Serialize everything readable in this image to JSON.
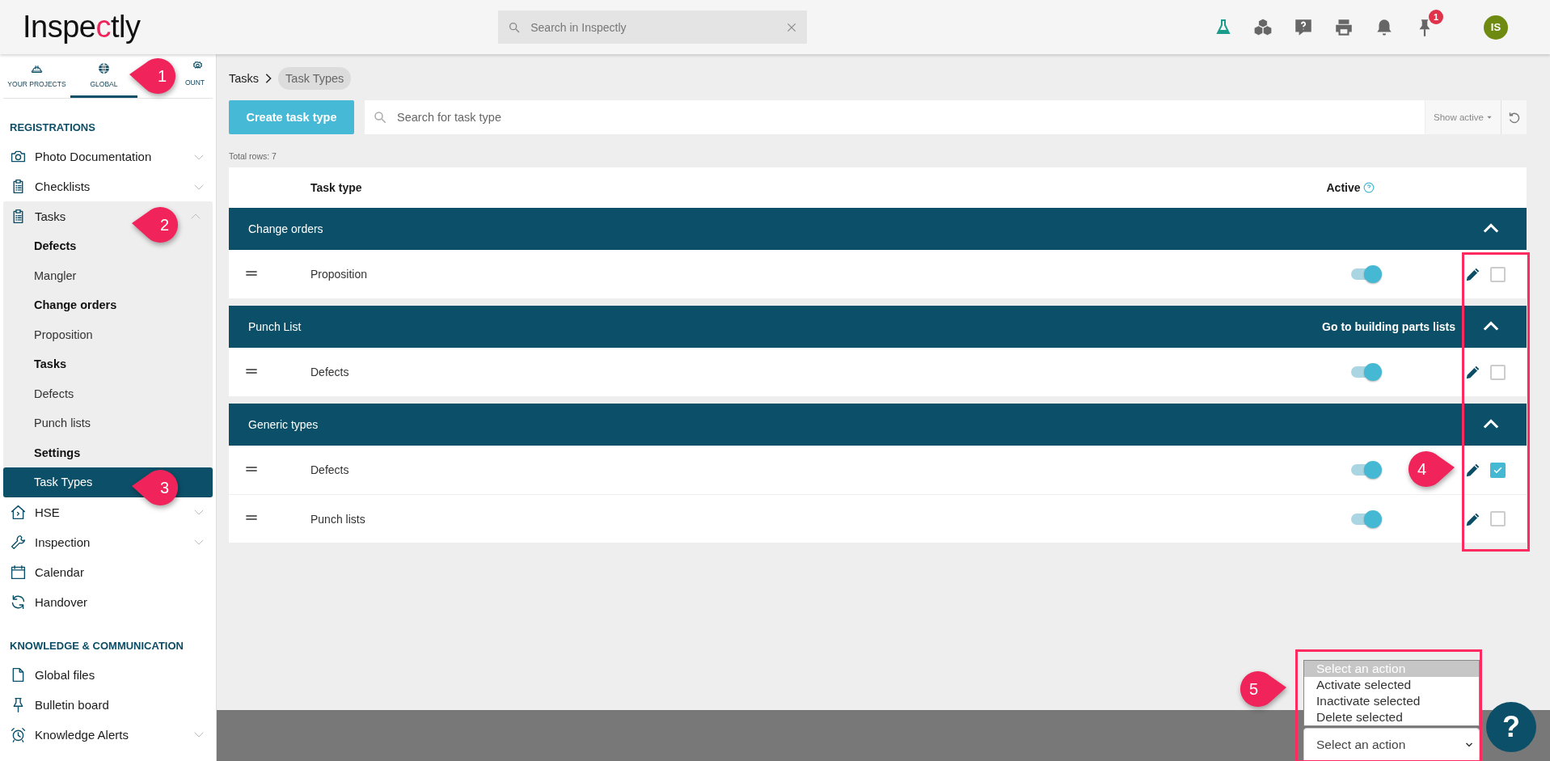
{
  "header": {
    "logo": {
      "before": "Inspe",
      "accent": "c",
      "after": "tly"
    },
    "search": {
      "placeholder": "Search in Inspectly"
    },
    "tools": [
      {
        "kind": "flask"
      },
      {
        "kind": "cubes"
      },
      {
        "kind": "help"
      },
      {
        "kind": "printer"
      },
      {
        "kind": "bell"
      },
      {
        "kind": "pin",
        "badge": "1"
      }
    ],
    "avatar": "IS"
  },
  "sidebar": {
    "tabs": [
      {
        "label": "YOUR PROJECTS",
        "kind": "hardhat",
        "selected": false
      },
      {
        "label": "GLOBAL",
        "kind": "globe",
        "selected": true
      },
      {
        "label": "OUNT",
        "kind": "gear",
        "selected": false
      }
    ],
    "sections": [
      {
        "title": "REGISTRATIONS",
        "items": [
          {
            "label": "Photo Documentation",
            "kind": "camera",
            "expanded": false
          },
          {
            "label": "Checklists",
            "kind": "clipboard",
            "expanded": false
          },
          {
            "label": "Tasks",
            "kind": "clipboard",
            "expanded": true,
            "children": [
              {
                "label": "Defects",
                "kind": "heading"
              },
              {
                "label": "Mangler",
                "kind": "link",
                "selected": false
              },
              {
                "label": "Change orders",
                "kind": "heading"
              },
              {
                "label": "Proposition",
                "kind": "link",
                "selected": false
              },
              {
                "label": "Tasks",
                "kind": "heading"
              },
              {
                "label": "Defects",
                "kind": "link",
                "selected": false
              },
              {
                "label": "Punch lists",
                "kind": "link",
                "selected": false
              },
              {
                "label": "Settings",
                "kind": "heading"
              },
              {
                "label": "Task Types",
                "kind": "link",
                "selected": true
              }
            ]
          },
          {
            "label": "HSE",
            "kind": "house",
            "expanded": false
          },
          {
            "label": "Inspection",
            "kind": "wrench",
            "expanded": false
          },
          {
            "label": "Calendar",
            "kind": "calendar"
          },
          {
            "label": "Handover",
            "kind": "sync"
          }
        ]
      },
      {
        "title": "KNOWLEDGE & COMMUNICATION",
        "items": [
          {
            "label": "Global files",
            "kind": "file"
          },
          {
            "label": "Bulletin board",
            "kind": "pin"
          },
          {
            "label": "Knowledge Alerts",
            "kind": "alarm",
            "expanded": false
          }
        ]
      }
    ]
  },
  "main": {
    "breadcrumb": [
      {
        "label": "Tasks",
        "current": false
      },
      {
        "label": "Task Types",
        "current": true
      }
    ],
    "create_button": "Create task type",
    "search": {
      "placeholder": "Search for task type"
    },
    "filter": "Show active",
    "total_rows": "Total rows: 7",
    "table": {
      "columns": [
        "Task type",
        "Active"
      ],
      "groups": [
        {
          "title": "Change orders",
          "expanded": true,
          "rows": [
            {
              "name": "Proposition",
              "active": true,
              "checked": false
            }
          ]
        },
        {
          "title": "Punch List",
          "link": "Go to building parts lists",
          "expanded": true,
          "rows": [
            {
              "name": "Defects",
              "active": true,
              "checked": false
            }
          ]
        },
        {
          "title": "Generic types",
          "expanded": true,
          "rows": [
            {
              "name": "Defects",
              "active": true,
              "checked": true
            },
            {
              "name": "Punch lists",
              "active": true,
              "checked": false
            }
          ]
        }
      ]
    },
    "actions": {
      "value": "Select an action",
      "open": true,
      "options": [
        {
          "label": "Select an action",
          "selected": true
        },
        {
          "label": "Activate selected",
          "selected": false
        },
        {
          "label": "Inactivate selected",
          "selected": false
        },
        {
          "label": "Delete selected",
          "selected": false
        }
      ]
    },
    "help_button": "?"
  },
  "annotations": {
    "callouts": [
      {
        "number": "1"
      },
      {
        "number": "2"
      },
      {
        "number": "3"
      },
      {
        "number": "4"
      },
      {
        "number": "5"
      }
    ]
  }
}
